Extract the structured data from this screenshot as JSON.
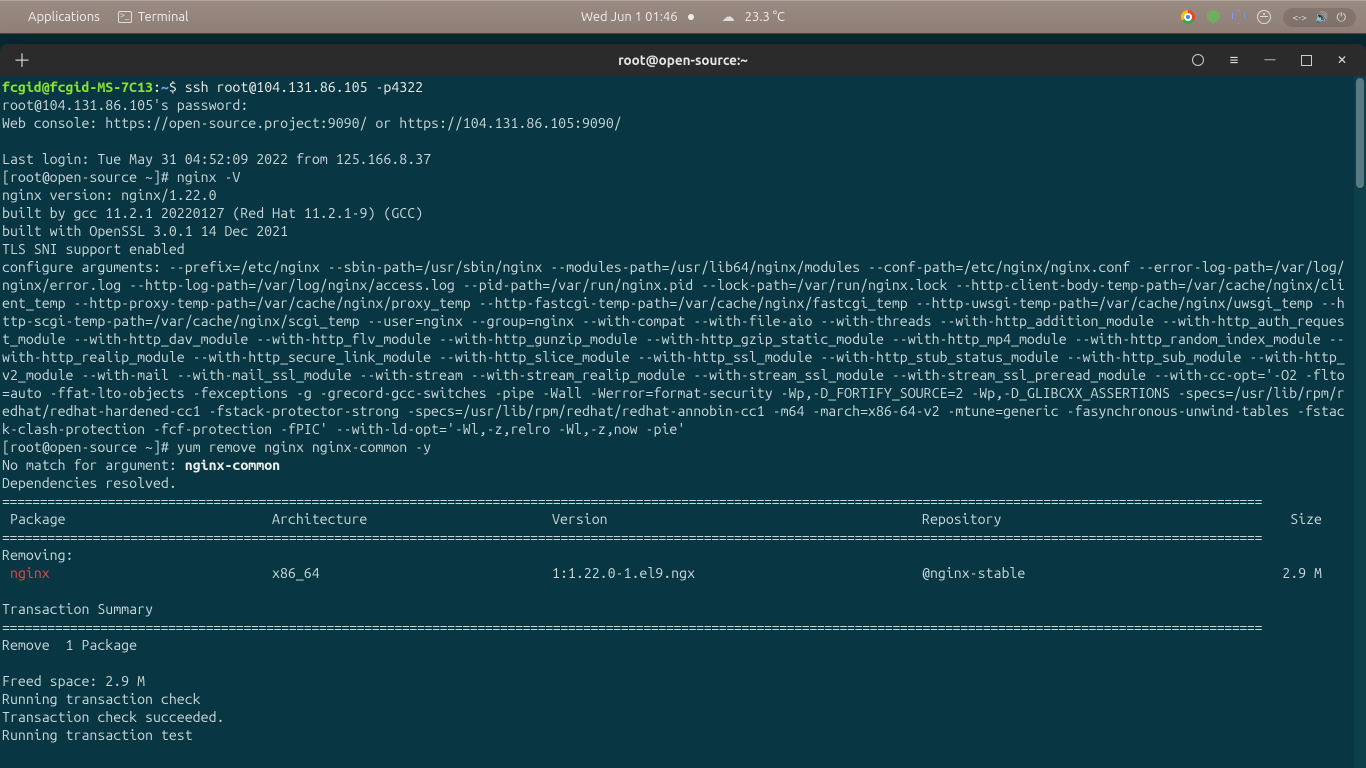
{
  "panel": {
    "apps_label": "Applications",
    "active_app": "Terminal",
    "datetime": "Wed Jun 1  01:46",
    "temperature": "23.3 °C"
  },
  "window": {
    "title": "root@open-source:~"
  },
  "terminal": {
    "local_prompt_user": "fcgid@fcgid-MS-7C13",
    "local_prompt_sep": ":",
    "local_prompt_path": "~",
    "local_prompt_suffix": "$ ",
    "ssh_cmd": "ssh root@104.131.86.105 -p4322",
    "password_prompt": "root@104.131.86.105's password: ",
    "web_console": "Web console: https://open-source.project:9090/ or https://104.131.86.105:9090/",
    "last_login": "Last login: Tue May 31 04:52:09 2022 from 125.166.8.37",
    "remote_prompt1": "[root@open-source ~]# ",
    "cmd1": "nginx -V",
    "nginx_version": "nginx version: nginx/1.22.0",
    "built_gcc": "built by gcc 11.2.1 20220127 (Red Hat 11.2.1-9) (GCC)",
    "built_openssl": "built with OpenSSL 3.0.1 14 Dec 2021",
    "tls_sni": "TLS SNI support enabled",
    "configure_args": "configure arguments: --prefix=/etc/nginx --sbin-path=/usr/sbin/nginx --modules-path=/usr/lib64/nginx/modules --conf-path=/etc/nginx/nginx.conf --error-log-path=/var/log/nginx/error.log --http-log-path=/var/log/nginx/access.log --pid-path=/var/run/nginx.pid --lock-path=/var/run/nginx.lock --http-client-body-temp-path=/var/cache/nginx/client_temp --http-proxy-temp-path=/var/cache/nginx/proxy_temp --http-fastcgi-temp-path=/var/cache/nginx/fastcgi_temp --http-uwsgi-temp-path=/var/cache/nginx/uwsgi_temp --http-scgi-temp-path=/var/cache/nginx/scgi_temp --user=nginx --group=nginx --with-compat --with-file-aio --with-threads --with-http_addition_module --with-http_auth_request_module --with-http_dav_module --with-http_flv_module --with-http_gunzip_module --with-http_gzip_static_module --with-http_mp4_module --with-http_random_index_module --with-http_realip_module --with-http_secure_link_module --with-http_slice_module --with-http_ssl_module --with-http_stub_status_module --with-http_sub_module --with-http_v2_module --with-mail --with-mail_ssl_module --with-stream --with-stream_realip_module --with-stream_ssl_module --with-stream_ssl_preread_module --with-cc-opt='-O2 -flto=auto -ffat-lto-objects -fexceptions -g -grecord-gcc-switches -pipe -Wall -Werror=format-security -Wp,-D_FORTIFY_SOURCE=2 -Wp,-D_GLIBCXX_ASSERTIONS -specs=/usr/lib/rpm/redhat/redhat-hardened-cc1 -fstack-protector-strong -specs=/usr/lib/rpm/redhat/redhat-annobin-cc1 -m64 -march=x86-64-v2 -mtune=generic -fasynchronous-unwind-tables -fstack-clash-protection -fcf-protection -fPIC' --with-ld-opt='-Wl,-z,relro -Wl,-z,now -pie'",
    "remote_prompt2": "[root@open-source ~]# ",
    "cmd2": "yum remove nginx nginx-common -y",
    "no_match": "No match for argument: ",
    "no_match_arg": "nginx-common",
    "deps_resolved": "Dependencies resolved.",
    "headers": {
      "package": "Package",
      "arch": "Architecture",
      "version": "Version",
      "repo": "Repository",
      "size": "Size"
    },
    "removing_label": "Removing:",
    "pkg_row": {
      "name": "nginx",
      "arch": "x86_64",
      "version": "1:1.22.0-1.el9.ngx",
      "repo": "@nginx-stable",
      "size": "2.9 M"
    },
    "tx_summary": "Transaction Summary",
    "remove_count": "Remove  1 Package",
    "freed_space": "Freed space: 2.9 M",
    "run_check": "Running transaction check",
    "check_ok": "Transaction check succeeded.",
    "run_test": "Running transaction test"
  }
}
